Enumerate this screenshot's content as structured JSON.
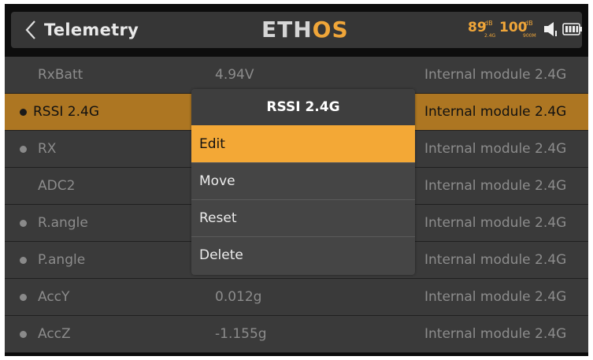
{
  "header": {
    "title": "Telemetry",
    "logo_part1": "ETH",
    "logo_part2": "OS",
    "rssi_24": "89",
    "rssi_24_unit": "dB",
    "rssi_24_band": "2.4G",
    "rssi_900": "100",
    "rssi_900_unit": "dB",
    "rssi_900_band": "900M",
    "accent_color": "#f0a639",
    "icons": [
      "back-chevron-icon",
      "speaker-icon",
      "battery-icon"
    ]
  },
  "rows": [
    {
      "name": "RxBatt",
      "value": "4.94V",
      "source": "Internal module 2.4G",
      "dot": false,
      "selected": false
    },
    {
      "name": "RSSI 2.4G",
      "value": "",
      "source": "Internal module 2.4G",
      "dot": true,
      "selected": true
    },
    {
      "name": "RX",
      "value": "",
      "source": "Internal module 2.4G",
      "dot": true,
      "selected": false
    },
    {
      "name": "ADC2",
      "value": "",
      "source": "Internal module 2.4G",
      "dot": false,
      "selected": false
    },
    {
      "name": "R.angle",
      "value": "",
      "source": "Internal module 2.4G",
      "dot": true,
      "selected": false
    },
    {
      "name": "P.angle",
      "value": "",
      "source": "Internal module 2.4G",
      "dot": true,
      "selected": false
    },
    {
      "name": "AccY",
      "value": "0.012g",
      "source": "Internal module 2.4G",
      "dot": true,
      "selected": false
    },
    {
      "name": "AccZ",
      "value": "-1.155g",
      "source": "Internal module 2.4G",
      "dot": true,
      "selected": false
    }
  ],
  "menu": {
    "title": "RSSI 2.4G",
    "items": [
      {
        "label": "Edit",
        "active": true
      },
      {
        "label": "Move",
        "active": false
      },
      {
        "label": "Reset",
        "active": false
      },
      {
        "label": "Delete",
        "active": false
      }
    ]
  },
  "colors": {
    "selected_row": "#ad7622",
    "menu_highlight": "#f3a836"
  }
}
